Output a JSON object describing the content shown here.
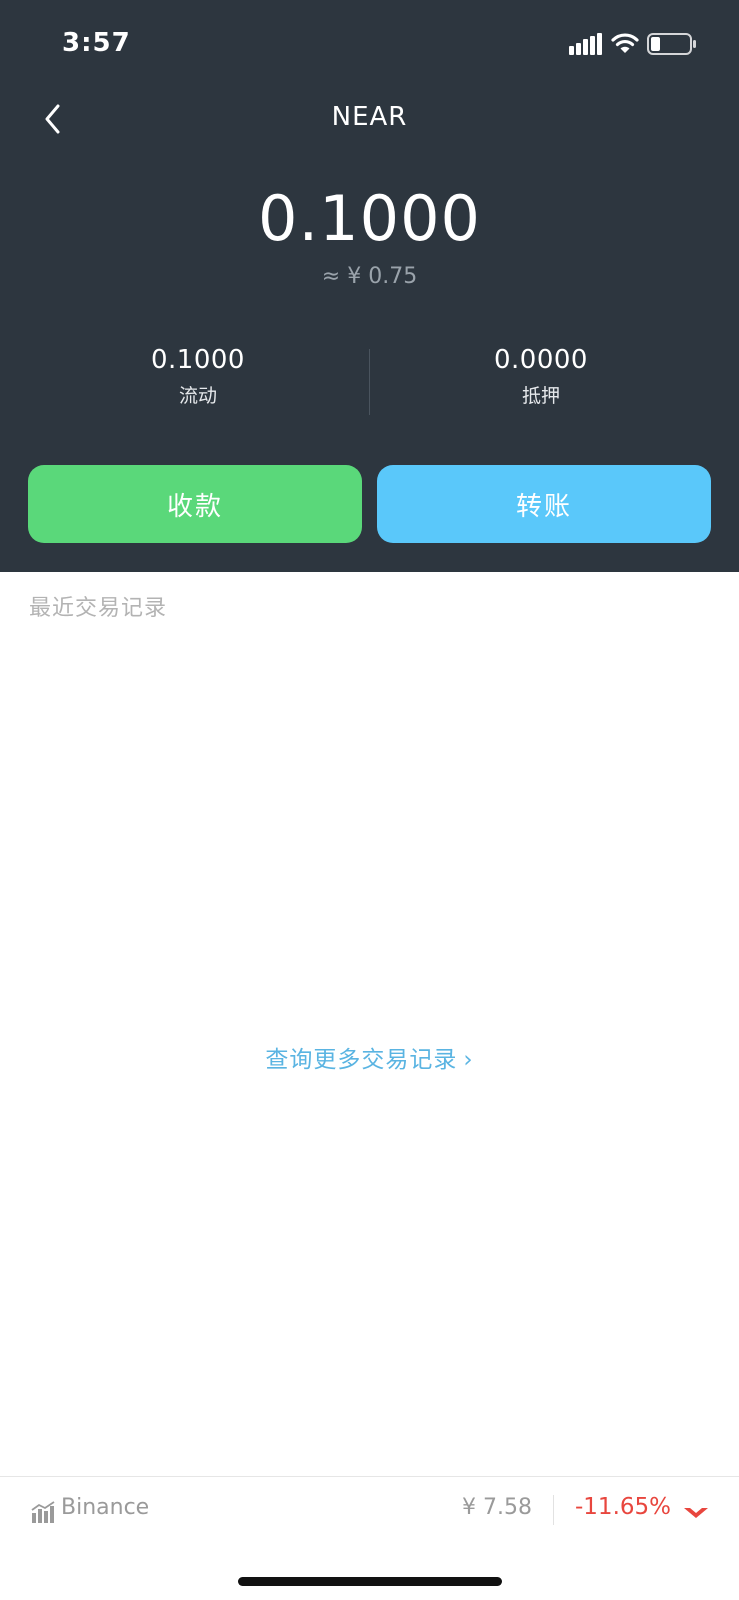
{
  "status_bar": {
    "time": "3:57"
  },
  "nav": {
    "title": "NEAR"
  },
  "balance": {
    "amount": "0.1000",
    "fiat": "≈ ¥ 0.75"
  },
  "stats": {
    "liquid": {
      "value": "0.1000",
      "label": "流动"
    },
    "staked": {
      "value": "0.0000",
      "label": "抵押"
    }
  },
  "actions": {
    "receive_label": "收款",
    "transfer_label": "转账"
  },
  "transactions": {
    "section_title": "最近交易记录",
    "more_link": "查询更多交易记录",
    "more_chevron": "›"
  },
  "footer": {
    "exchange": "Binance",
    "price": "¥ 7.58",
    "change": "-11.65%"
  },
  "colors": {
    "header_bg": "#2d363f",
    "receive_button": "#5ad87a",
    "transfer_button": "#5ac8fa",
    "link": "#5ab4e2",
    "negative": "#e8463e"
  },
  "icons": {
    "back": "back-chevron-icon",
    "signal": "cellular-signal-icon",
    "wifi": "wifi-icon",
    "battery": "battery-icon",
    "exchange": "bar-chart-icon",
    "trend": "trend-down-icon"
  }
}
